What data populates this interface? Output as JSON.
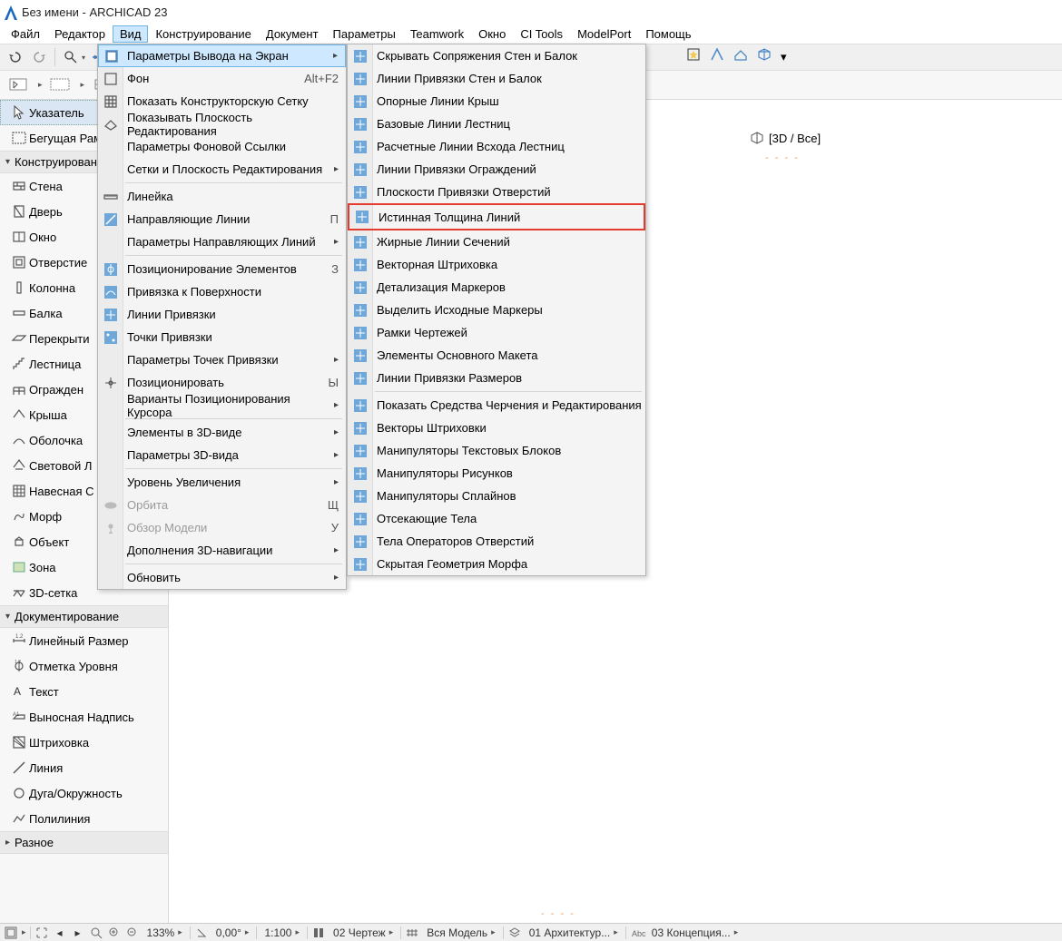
{
  "titlebar": {
    "title": "Без имени - ARCHICAD 23"
  },
  "menubar": [
    "Файл",
    "Редактор",
    "Вид",
    "Конструирование",
    "Документ",
    "Параметры",
    "Teamwork",
    "Окно",
    "CI Tools",
    "ModelPort",
    "Помощь"
  ],
  "menubar_active_index": 2,
  "sidebar": {
    "selected_index": 0,
    "items": [
      {
        "label": "Указатель",
        "icon": "cursor"
      },
      {
        "label": "Бегущая Рам",
        "icon": "marquee"
      }
    ],
    "section1": {
      "title": "Конструировани",
      "items": [
        {
          "label": "Стена",
          "icon": "wall"
        },
        {
          "label": "Дверь",
          "icon": "door"
        },
        {
          "label": "Окно",
          "icon": "window"
        },
        {
          "label": "Отверстие",
          "icon": "opening"
        },
        {
          "label": "Колонна",
          "icon": "column"
        },
        {
          "label": "Балка",
          "icon": "beam"
        },
        {
          "label": "Перекрыти",
          "icon": "slab"
        },
        {
          "label": "Лестница",
          "icon": "stair"
        },
        {
          "label": "Огражден",
          "icon": "railing"
        },
        {
          "label": "Крыша",
          "icon": "roof"
        },
        {
          "label": "Оболочка",
          "icon": "shell"
        },
        {
          "label": "Световой Л",
          "icon": "skylight"
        },
        {
          "label": "Навесная С",
          "icon": "curtainwall"
        },
        {
          "label": "Морф",
          "icon": "morph"
        },
        {
          "label": "Объект",
          "icon": "object"
        },
        {
          "label": "Зона",
          "icon": "zone"
        },
        {
          "label": "3D-сетка",
          "icon": "mesh"
        }
      ]
    },
    "section2": {
      "title": "Документирование",
      "items": [
        {
          "label": "Линейный Размер",
          "icon": "lindim"
        },
        {
          "label": "Отметка Уровня",
          "icon": "level"
        },
        {
          "label": "Текст",
          "icon": "text"
        },
        {
          "label": "Выносная Надпись",
          "icon": "label"
        },
        {
          "label": "Штриховка",
          "icon": "fill"
        },
        {
          "label": "Линия",
          "icon": "line"
        },
        {
          "label": "Дуга/Окружность",
          "icon": "arc"
        },
        {
          "label": "Полилиния",
          "icon": "polyline"
        }
      ]
    },
    "section3": {
      "title": "Разное"
    }
  },
  "dropdown": {
    "items": [
      {
        "label": "Параметры Вывода на Экран",
        "submenu": true,
        "active": true,
        "icon": "screenopts"
      },
      {
        "label": "Фон",
        "shortcut": "Alt+F2",
        "icon": "bg"
      },
      {
        "label": "Показать Конструкторскую Сетку",
        "icon": "grid"
      },
      {
        "label": "Показывать Плоскость Редактирования",
        "icon": "plane"
      },
      {
        "label": "Параметры Фоновой Ссылки"
      },
      {
        "label": "Сетки и Плоскость Редактирования",
        "submenu": true
      },
      {
        "sep": true
      },
      {
        "label": "Линейка",
        "icon": "ruler"
      },
      {
        "label": "Направляющие Линии",
        "shortcut": "П",
        "icon": "guide"
      },
      {
        "label": "Параметры Направляющих Линий",
        "submenu": true
      },
      {
        "sep": true
      },
      {
        "label": "Позиционирование Элементов",
        "shortcut": "З",
        "icon": "snap"
      },
      {
        "label": "Привязка к Поверхности",
        "icon": "surfsnap"
      },
      {
        "label": "Линии Привязки",
        "icon": "snaplines"
      },
      {
        "label": "Точки Привязки",
        "icon": "snappoints"
      },
      {
        "label": "Параметры Точек Привязки",
        "submenu": true
      },
      {
        "label": "Позиционировать",
        "shortcut": "Ы",
        "icon": "position"
      },
      {
        "label": "Варианты Позиционирования Курсора",
        "submenu": true
      },
      {
        "sep": true
      },
      {
        "label": "Элементы в 3D-виде",
        "submenu": true
      },
      {
        "label": "Параметры 3D-вида",
        "submenu": true
      },
      {
        "sep": true
      },
      {
        "label": "Уровень Увеличения",
        "submenu": true
      },
      {
        "label": "Орбита",
        "shortcut": "Щ",
        "disabled": true,
        "icon": "orbit"
      },
      {
        "label": "Обзор Модели",
        "shortcut": "У",
        "disabled": true,
        "icon": "explore"
      },
      {
        "label": "Дополнения 3D-навигации",
        "submenu": true
      },
      {
        "sep": true
      },
      {
        "label": "Обновить",
        "submenu": true
      }
    ]
  },
  "submenu": {
    "highlighted_index": 7,
    "items": [
      {
        "label": "Скрывать Сопряжения Стен и Балок",
        "icon": "hidejoints"
      },
      {
        "label": "Линии Привязки Стен и Балок",
        "icon": "reflines"
      },
      {
        "label": "Опорные Линии Крыш",
        "icon": "roofref"
      },
      {
        "label": "Базовые Линии Лестниц",
        "icon": "stairbase"
      },
      {
        "label": "Расчетные Линии Всхода Лестниц",
        "icon": "walkline"
      },
      {
        "label": "Линии Привязки Ограждений",
        "icon": "railref"
      },
      {
        "label": "Плоскости Привязки Отверстий",
        "icon": "openref"
      },
      {
        "label": "Истинная Толщина Линий",
        "icon": "trueweight"
      },
      {
        "label": "Жирные Линии Сечений",
        "icon": "boldcut"
      },
      {
        "label": "Векторная Штриховка",
        "icon": "vecfill"
      },
      {
        "label": "Детализация Маркеров",
        "icon": "markerdetail"
      },
      {
        "label": "Выделить Исходные Маркеры",
        "icon": "srcmarker"
      },
      {
        "label": "Рамки Чертежей",
        "icon": "dwgframe"
      },
      {
        "label": "Элементы Основного Макета",
        "icon": "masteritems"
      },
      {
        "label": "Линии Привязки Размеров",
        "icon": "dimref"
      },
      {
        "sep": true
      },
      {
        "label": "Показать Средства Черчения и Редактирования",
        "icon": "drawtools"
      },
      {
        "label": "Векторы Штриховки",
        "icon": "hatchvec"
      },
      {
        "label": "Манипуляторы Текстовых Блоков",
        "icon": "texthand"
      },
      {
        "label": "Манипуляторы Рисунков",
        "icon": "fighand"
      },
      {
        "label": "Манипуляторы Сплайнов",
        "icon": "splinehand"
      },
      {
        "label": "Отсекающие Тела",
        "icon": "cutbody"
      },
      {
        "label": "Тела Операторов Отверстий",
        "icon": "openop"
      },
      {
        "label": "Скрытая Геометрия Морфа",
        "icon": "hiddenmorph"
      }
    ]
  },
  "view_tab": {
    "label": "[3D / Все]"
  },
  "statusbar": {
    "zoom": "133%",
    "angle": "0,00°",
    "scale": "1:100",
    "view": "02 Чертеж",
    "model": "Вся Модель",
    "layers": "01 Архитектур...",
    "docset": "03 Концепция..."
  }
}
